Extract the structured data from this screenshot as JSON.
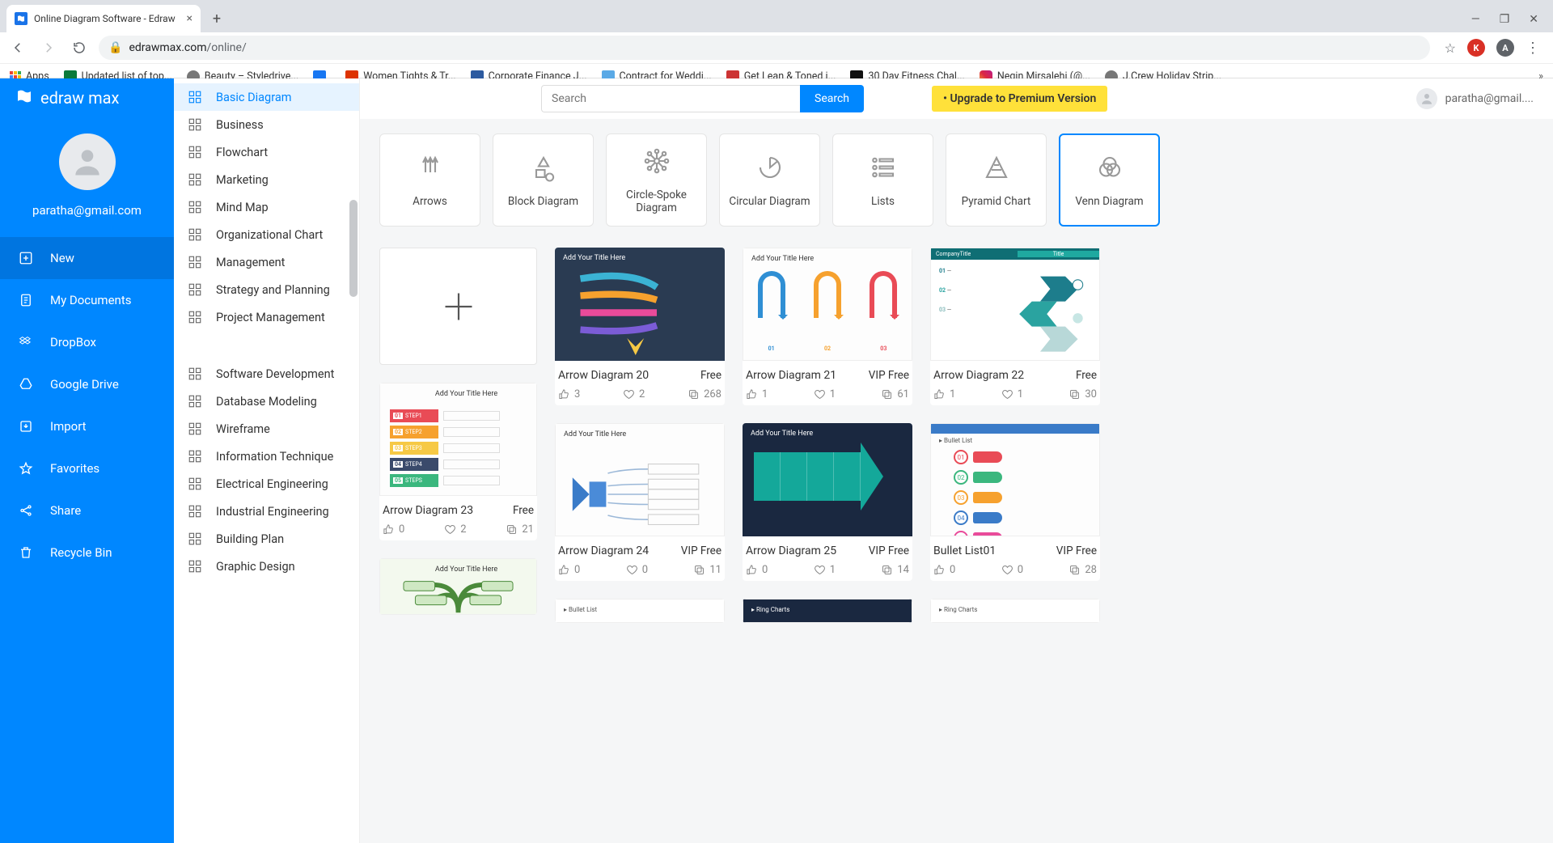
{
  "browser": {
    "tab_title": "Online Diagram Software - Edraw",
    "url_domain": "edrawmax.com",
    "url_path": "/online/",
    "bookmarks": [
      {
        "label": "Apps",
        "icon": "apps"
      },
      {
        "label": "Updated list of top...",
        "color": "#0b7a3b"
      },
      {
        "label": "Beauty – Styledrive...",
        "color": "#777"
      },
      {
        "label": "",
        "color": "#1877f2"
      },
      {
        "label": "Women Tights & Tr...",
        "color": "#d30"
      },
      {
        "label": "Corporate Finance J...",
        "color": "#2c5aa0"
      },
      {
        "label": "Contract for Weddi...",
        "color": "#5aa9e6"
      },
      {
        "label": "Get Lean & Toned i...",
        "color": "#c33"
      },
      {
        "label": "30 Day Fitness Chal...",
        "color": "#111"
      },
      {
        "label": "Negin Mirsalehi (@...",
        "color": "#e1306c"
      },
      {
        "label": "J.Crew Holiday Strip...",
        "color": "#777"
      }
    ]
  },
  "app": {
    "logo_text": "edraw max",
    "user_email": "paratha@gmail.com",
    "user_email_short": "paratha@gmail....",
    "search_placeholder": "Search",
    "search_button": "Search",
    "upgrade_label": "Upgrade to Premium Version"
  },
  "left_nav": [
    {
      "label": "New",
      "icon": "plus-square",
      "active": true
    },
    {
      "label": "My Documents",
      "icon": "doc"
    },
    {
      "label": "DropBox",
      "icon": "dropbox"
    },
    {
      "label": "Google Drive",
      "icon": "gdrive"
    },
    {
      "label": "Import",
      "icon": "import"
    },
    {
      "label": "Favorites",
      "icon": "star"
    },
    {
      "label": "Share",
      "icon": "share"
    },
    {
      "label": "Recycle Bin",
      "icon": "trash"
    }
  ],
  "categories_top": [
    {
      "label": "Basic Diagram",
      "active": true
    },
    {
      "label": "Business"
    },
    {
      "label": "Flowchart"
    },
    {
      "label": "Marketing"
    },
    {
      "label": "Mind Map"
    },
    {
      "label": "Organizational Chart"
    },
    {
      "label": "Management"
    },
    {
      "label": "Strategy and Planning"
    },
    {
      "label": "Project Management"
    }
  ],
  "categories_bottom": [
    {
      "label": "Software Development"
    },
    {
      "label": "Database Modeling"
    },
    {
      "label": "Wireframe"
    },
    {
      "label": "Information Technique"
    },
    {
      "label": "Electrical Engineering"
    },
    {
      "label": "Industrial Engineering"
    },
    {
      "label": "Building Plan"
    },
    {
      "label": "Graphic Design"
    }
  ],
  "diagram_types": [
    {
      "label": "Arrows"
    },
    {
      "label": "Block Diagram"
    },
    {
      "label": "Circle-Spoke Diagram"
    },
    {
      "label": "Circular Diagram"
    },
    {
      "label": "Lists"
    },
    {
      "label": "Pyramid Chart"
    },
    {
      "label": "Venn Diagram",
      "selected": true
    }
  ],
  "templates": [
    {
      "name": "Arrow Diagram 23",
      "price": "Free",
      "likes": "0",
      "favs": "2",
      "copies": "21",
      "style": "steps",
      "narrow": true
    },
    {
      "name": "Arrow Diagram 20",
      "price": "Free",
      "likes": "3",
      "favs": "2",
      "copies": "268",
      "style": "dark-arrows"
    },
    {
      "name": "Arrow Diagram 21",
      "price": "VIP Free",
      "likes": "1",
      "favs": "1",
      "copies": "61",
      "style": "tri-arrows"
    },
    {
      "name": "Arrow Diagram 22",
      "price": "Free",
      "likes": "1",
      "favs": "1",
      "copies": "30",
      "style": "teal-arrows"
    },
    {
      "name": "Arrow Diagram 24",
      "price": "VIP Free",
      "likes": "0",
      "favs": "0",
      "copies": "11",
      "style": "blue-arrow"
    },
    {
      "name": "Arrow Diagram 25",
      "price": "VIP Free",
      "likes": "0",
      "favs": "1",
      "copies": "14",
      "style": "big-teal"
    },
    {
      "name": "Bullet List01",
      "price": "VIP Free",
      "likes": "0",
      "favs": "0",
      "copies": "28",
      "style": "bullets"
    }
  ],
  "thumb_text": {
    "add_title": "Add Your Title Here"
  }
}
